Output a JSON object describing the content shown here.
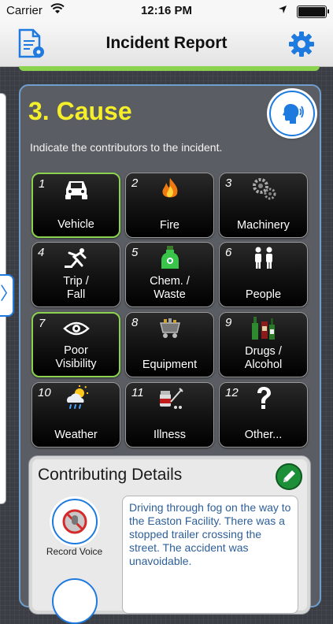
{
  "status_bar": {
    "carrier": "Carrier",
    "time": "12:16 PM"
  },
  "nav": {
    "title": "Incident Report",
    "left_icon": "document-settings-icon",
    "right_icon": "gear-icon",
    "accent_color": "#1f7ae0"
  },
  "cause": {
    "title": "3. Cause",
    "instructions": "Indicate the contributors to the incident.",
    "title_color": "#f5ee2a",
    "tiles": [
      {
        "num": "1",
        "label": "Vehicle",
        "icon": "car-icon",
        "selected": true
      },
      {
        "num": "2",
        "label": "Fire",
        "icon": "fire-icon",
        "selected": false
      },
      {
        "num": "3",
        "label": "Machinery",
        "icon": "gears-icon",
        "selected": false
      },
      {
        "num": "4",
        "label": "Trip /\nFall",
        "icon": "trip-fall-icon",
        "selected": false
      },
      {
        "num": "5",
        "label": "Chem. /\nWaste",
        "icon": "chemical-bottle-icon",
        "selected": false
      },
      {
        "num": "6",
        "label": "People",
        "icon": "people-icon",
        "selected": false
      },
      {
        "num": "7",
        "label": "Poor\nVisibility",
        "icon": "eye-icon",
        "selected": true
      },
      {
        "num": "8",
        "label": "Equipment",
        "icon": "cart-equipment-icon",
        "selected": false
      },
      {
        "num": "9",
        "label": "Drugs /\nAlcohol",
        "icon": "bottles-icon",
        "selected": false
      },
      {
        "num": "10",
        "label": "Weather",
        "icon": "weather-icon",
        "selected": false
      },
      {
        "num": "11",
        "label": "Illness",
        "icon": "illness-icon",
        "selected": false
      },
      {
        "num": "12",
        "label": "Other...",
        "icon": "question-icon",
        "selected": false
      }
    ],
    "selected_color": "#8bd34f"
  },
  "details": {
    "title": "Contributing Details",
    "record_label": "Record Voice",
    "text": "Driving through fog on the way to the Easton Facility. There was a stopped trailer crossing the street. The accident was unavoidable.",
    "text_color": "#2d5f99"
  }
}
